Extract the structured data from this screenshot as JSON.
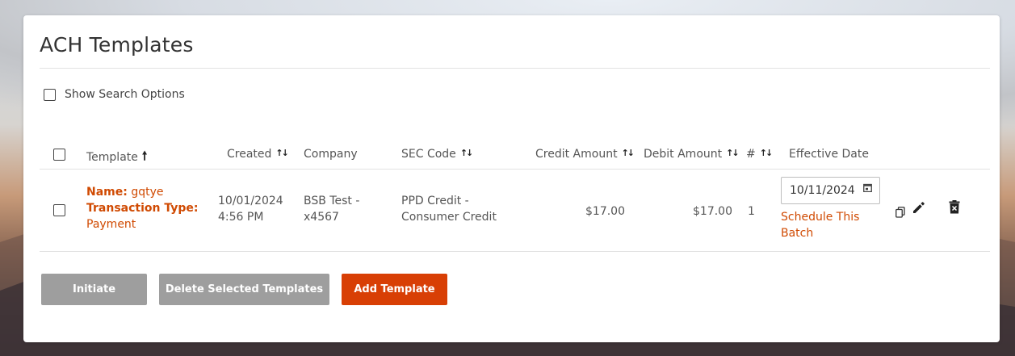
{
  "page": {
    "title": "ACH Templates"
  },
  "search_options": {
    "label": "Show Search Options",
    "checked": false
  },
  "table": {
    "columns": {
      "template": "Template",
      "created": "Created",
      "company": "Company",
      "sec_code": "SEC Code",
      "credit_amount": "Credit Amount",
      "debit_amount": "Debit Amount",
      "count": "#",
      "effective_date": "Effective Date"
    },
    "rows": [
      {
        "name_label": "Name:",
        "name_value": "gqtye",
        "transaction_type_label": "Transaction Type:",
        "transaction_type_value": "Payment",
        "created_date": "10/01/2024",
        "created_time": "4:56 PM",
        "company_line1": "BSB Test -",
        "company_line2": "x4567",
        "sec_line1": "PPD Credit -",
        "sec_line2": "Consumer Credit",
        "credit_amount": "$17.00",
        "debit_amount": "$17.00",
        "count": "1",
        "effective_date": "10/11/2024",
        "schedule_link": "Schedule This Batch"
      }
    ]
  },
  "buttons": {
    "initiate": "Initiate",
    "delete_selected": "Delete Selected Templates",
    "add_template": "Add Template"
  },
  "colors": {
    "accent": "#d04a02",
    "primary_button": "#d83f05",
    "disabled_button": "#9e9e9e"
  }
}
